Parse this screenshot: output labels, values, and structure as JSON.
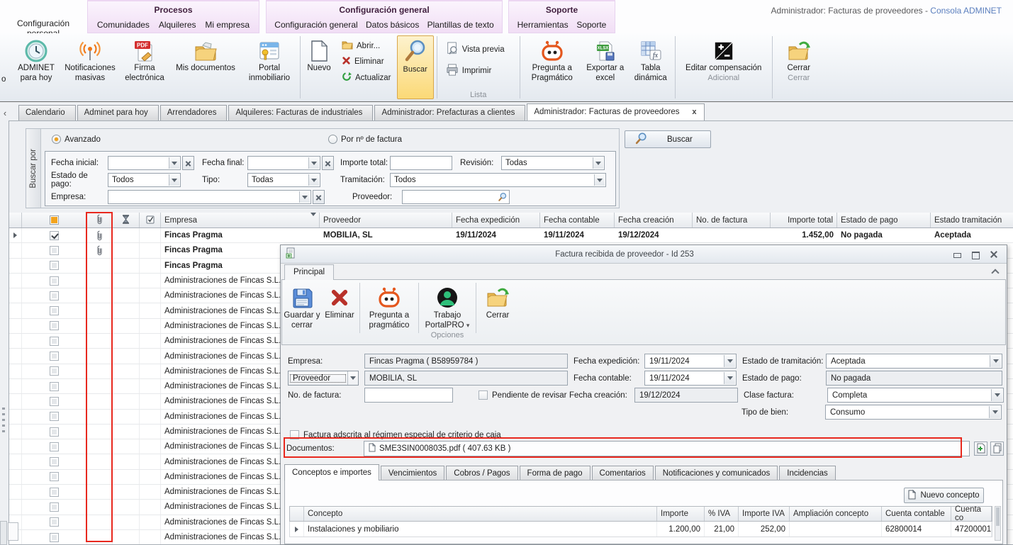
{
  "colors": {
    "highlight_red": "#e8281e",
    "selected_button_bg": "#fbd977",
    "ribbon_group_bg": "#f1def5",
    "link_blue": "#5b7fbe",
    "robot_orange": "#e4571e"
  },
  "ribbon": {
    "personal_tab": "Configuración personal",
    "groups": [
      {
        "title": "Procesos",
        "items": [
          "Comunidades",
          "Alquileres",
          "Mi empresa"
        ]
      },
      {
        "title": "Configuración general",
        "items": [
          "Configuración general",
          "Datos básicos",
          "Plantillas de texto"
        ]
      },
      {
        "title": "Soporte",
        "items": [
          "Herramientas",
          "Soporte"
        ]
      }
    ],
    "window_title": "Administrador: Facturas de proveedores",
    "window_title_sep": " - ",
    "window_title_link": "Consola ADMINET"
  },
  "toolbar": {
    "clipped_label": "o",
    "adminet_hoy": "ADMINET para hoy",
    "notificaciones": "Notificaciones masivas",
    "firma": "Firma electrónica",
    "mis_documentos": "Mis documentos",
    "portal": "Portal inmobiliario",
    "nuevo": "Nuevo",
    "abrir": "Abrir...",
    "eliminar": "Eliminar",
    "actualizar": "Actualizar",
    "buscar": "Buscar",
    "vista_previa": "Vista previa",
    "imprimir": "Imprimir",
    "lista_caption": "Lista",
    "pregunta": "Pregunta a Pragmático",
    "exportar": "Exportar a excel",
    "tabla_dinamica": "Tabla dinámica",
    "editar_comp": "Editar compensación",
    "adicional_caption": "Adicional",
    "cerrar": "Cerrar",
    "cerrar_caption": "Cerrar"
  },
  "tabstrip": {
    "scroll_left": "‹",
    "tabs": [
      {
        "label": "Calendario"
      },
      {
        "label": "Adminet para hoy"
      },
      {
        "label": "Arrendadores"
      },
      {
        "label": "Alquileres: Facturas de industriales"
      },
      {
        "label": "Administrador: Prefacturas a clientes"
      },
      {
        "label": "Administrador: Facturas de proveedores",
        "active": true,
        "close": "x"
      }
    ]
  },
  "search": {
    "vertical_label": "Buscar por",
    "radio_avanzado": "Avanzado",
    "radio_numero": "Por nº de factura",
    "buscar_btn": "Buscar",
    "fecha_inicial_label": "Fecha inicial:",
    "fecha_final_label": "Fecha final:",
    "importe_total_label": "Importe total:",
    "revision_label": "Revisión:",
    "revision_value": "Todas",
    "estado_pago_label": "Estado de pago:",
    "estado_pago_value": "Todos",
    "tipo_label": "Tipo:",
    "tipo_value": "Todas",
    "tramitacion_label": "Tramitación:",
    "tramitacion_value": "Todos",
    "empresa_label": "Empresa:",
    "proveedor_label": "Proveedor:"
  },
  "grid": {
    "headers": {
      "empresa": "Empresa",
      "proveedor": "Proveedor",
      "fecha_expedicion": "Fecha expedición",
      "fecha_contable": "Fecha contable",
      "fecha_creacion": "Fecha creación",
      "no_factura": "No. de factura",
      "importe_total": "Importe total",
      "estado_pago": "Estado de pago",
      "estado_tramitacion": "Estado tramitación"
    },
    "rows": [
      {
        "selected": true,
        "checked": true,
        "clip": true,
        "bold": true,
        "empresa": "Fincas Pragma",
        "proveedor": "MOBILIA, SL",
        "fecha_expedicion": "19/11/2024",
        "fecha_contable": "19/11/2024",
        "fecha_creacion": "19/12/2024",
        "no_factura": "",
        "importe_total": "1.452,00",
        "estado_pago": "No pagada",
        "estado_tramitacion": "Aceptada"
      },
      {
        "clip": true,
        "bold": true,
        "empresa": "Fincas Pragma"
      },
      {
        "bold": true,
        "empresa": "Fincas Pragma"
      },
      {
        "empresa": "Administraciones de Fincas S.L."
      },
      {
        "empresa": "Administraciones de Fincas S.L."
      },
      {
        "empresa": "Administraciones de Fincas S.L."
      },
      {
        "empresa": "Administraciones de Fincas S.L."
      },
      {
        "empresa": "Administraciones de Fincas S.L."
      },
      {
        "empresa": "Administraciones de Fincas S.L."
      },
      {
        "empresa": "Administraciones de Fincas S.L."
      },
      {
        "empresa": "Administraciones de Fincas S.L."
      },
      {
        "empresa": "Administraciones de Fincas S.L."
      },
      {
        "empresa": "Administraciones de Fincas S.L."
      },
      {
        "empresa": "Administraciones de Fincas S.L."
      },
      {
        "empresa": "Administraciones de Fincas S.L."
      },
      {
        "empresa": "Administraciones de Fincas S.L."
      },
      {
        "empresa": "Administraciones de Fincas S.L."
      },
      {
        "empresa": "Administraciones de Fincas S.L."
      },
      {
        "empresa": "Administraciones de Fincas S.L."
      },
      {
        "empresa": "Administraciones de Fincas S.L."
      },
      {
        "empresa": "Administraciones de Fincas S.L."
      }
    ]
  },
  "dialog": {
    "title": "Factura recibida de proveedor - Id 253",
    "tab": "Principal",
    "toolbar": {
      "guardar": "Guardar y cerrar",
      "eliminar": "Eliminar",
      "pregunta": "Pregunta a pragmático",
      "trabajo": "Trabajo PortalPRO",
      "cerrar": "Cerrar",
      "opciones_caption": "Opciones"
    },
    "form": {
      "empresa_label": "Empresa:",
      "empresa_value": "Fincas Pragma ( B58959784 )",
      "proveedor_label": "Proveedor",
      "proveedor_value": "MOBILIA, SL",
      "no_factura_label": "No. de factura:",
      "pendiente_label": "Pendiente de revisar",
      "fecha_expedicion_label": "Fecha expedición:",
      "fecha_expedicion_value": "19/11/2024",
      "fecha_contable_label": "Fecha contable:",
      "fecha_contable_value": "19/11/2024",
      "fecha_creacion_label": "Fecha creación:",
      "fecha_creacion_value": "19/12/2024",
      "estado_tramitacion_label": "Estado de tramitación:",
      "estado_tramitacion_value": "Aceptada",
      "estado_pago_label": "Estado de pago:",
      "estado_pago_value": "No pagada",
      "clase_factura_label": "Clase factura:",
      "clase_factura_value": "Completa",
      "tipo_bien_label": "Tipo de bien:",
      "tipo_bien_value": "Consumo",
      "regimen_caja_label": "Factura adscrita al régimen especial de criterio de caja",
      "documentos_label": "Documentos:",
      "documento_value": "SME3SIN0008035.pdf ( 407.63 KB )"
    },
    "tabs": [
      {
        "label": "Conceptos e importes",
        "active": true
      },
      {
        "label": "Vencimientos"
      },
      {
        "label": "Cobros / Pagos"
      },
      {
        "label": "Forma de pago"
      },
      {
        "label": "Comentarios"
      },
      {
        "label": "Notificaciones y comunicados"
      },
      {
        "label": "Incidencias"
      }
    ],
    "nuevo_concepto": "Nuevo concepto",
    "concepts": {
      "headers": {
        "concepto": "Concepto",
        "importe": "Importe",
        "iva": "% IVA",
        "importe_iva": "Importe IVA",
        "ampliacion": "Ampliación concepto",
        "cuenta_contable": "Cuenta contable",
        "cuenta_co": "Cuenta co"
      },
      "rows": [
        {
          "selected": true,
          "concepto": "Instalaciones y mobiliario",
          "importe": "1.200,00",
          "iva": "21,00",
          "importe_iva": "252,00",
          "ampliacion": "",
          "cuenta_contable": "62800014",
          "cuenta_co": "47200001"
        }
      ]
    }
  }
}
